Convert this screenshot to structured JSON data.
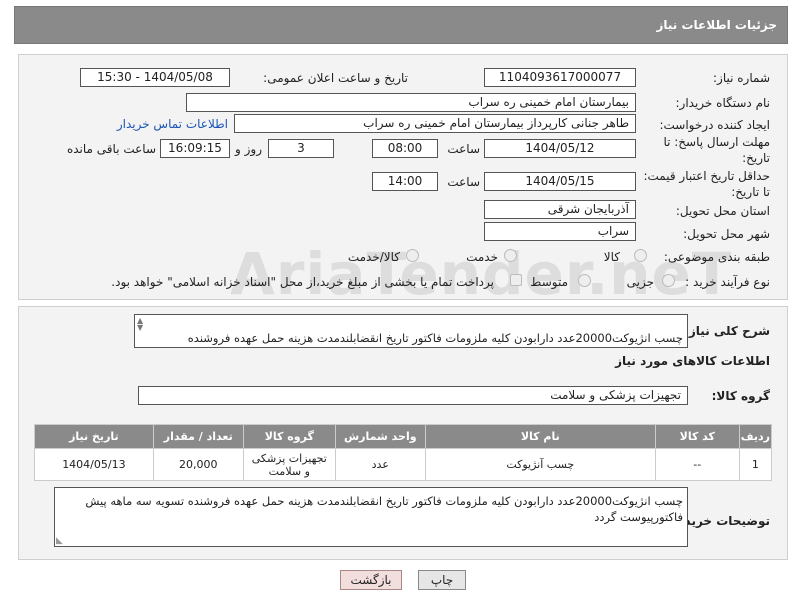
{
  "header": {
    "title": "جزئیات اطلاعات نیاز"
  },
  "fields": {
    "need_number_label": "شماره نیاز:",
    "need_number": "1104093617000077",
    "announce_label": "تاریخ و ساعت اعلان عمومی:",
    "announce_value": "1404/05/08 - 15:30",
    "buyer_org_label": "نام دستگاه خریدار:",
    "buyer_org": "بیمارستان امام خمینی ره  سراب",
    "requester_label": "ایجاد کننده درخواست:",
    "requester": "طاهر جنانی کارپرداز بیمارستان امام خمینی ره  سراب",
    "buyer_contact_link": "اطلاعات تماس خریدار",
    "reply_deadline_label": "مهلت ارسال پاسخ: تا تاریخ:",
    "reply_date": "1404/05/12",
    "time_label": "ساعت",
    "reply_time": "08:00",
    "days_count": "3",
    "days_label": "روز و",
    "remaining_time": "16:09:15",
    "remaining_label": "ساعت باقی مانده",
    "price_validity_label": "حداقل تاریخ اعتبار قیمت: تا تاریخ:",
    "validity_date": "1404/05/15",
    "validity_time": "14:00",
    "province_label": "استان محل تحویل:",
    "province": "آذربایجان شرقی",
    "city_label": "شهر محل تحویل:",
    "city": "سراب",
    "category_label": "طبقه بندی موضوعی:",
    "category_options": [
      "کالا",
      "خدمت",
      "کالا/خدمت"
    ],
    "purchase_type_label": "نوع فرآیند خرید :",
    "purchase_options": [
      "جزیی",
      "متوسط"
    ],
    "payment_note": "پرداخت تمام یا بخشی از مبلغ خرید،از محل \"اسناد خزانه اسلامی\" خواهد بود."
  },
  "description": {
    "label": "شرح کلی نیاز:",
    "text": "چسب انژیوکت20000عدد دارابودن کلیه ملزومات فاکتور تاریخ انقضابلندمدت هزینه حمل عهده فروشنده"
  },
  "goods_info": {
    "title": "اطلاعات کالاهای مورد نیاز",
    "group_label": "گروه کالا:",
    "group_value": "تجهیزات پزشکی و سلامت"
  },
  "table": {
    "headers": [
      "ردیف",
      "کد کالا",
      "نام کالا",
      "واحد شمارش",
      "گروه کالا",
      "تعداد / مقدار",
      "تاریخ نیاز"
    ],
    "rows": [
      [
        "1",
        "--",
        "چسب آنژیوکت",
        "عدد",
        "تجهیزات پزشکی و سلامت",
        "20,000",
        "1404/05/13"
      ]
    ]
  },
  "buyer_notes": {
    "label": "توضیحات خریدار:",
    "text": "چسب انژیوکت20000عدد دارابودن کلیه ملزومات فاکتور تاریخ انقضابلندمدت هزینه حمل عهده فروشنده تسویه سه ماهه پیش فاکتورپیوست گردد"
  },
  "buttons": {
    "print": "چاپ",
    "back": "بازگشت"
  },
  "watermark": "AriaTender.neT"
}
